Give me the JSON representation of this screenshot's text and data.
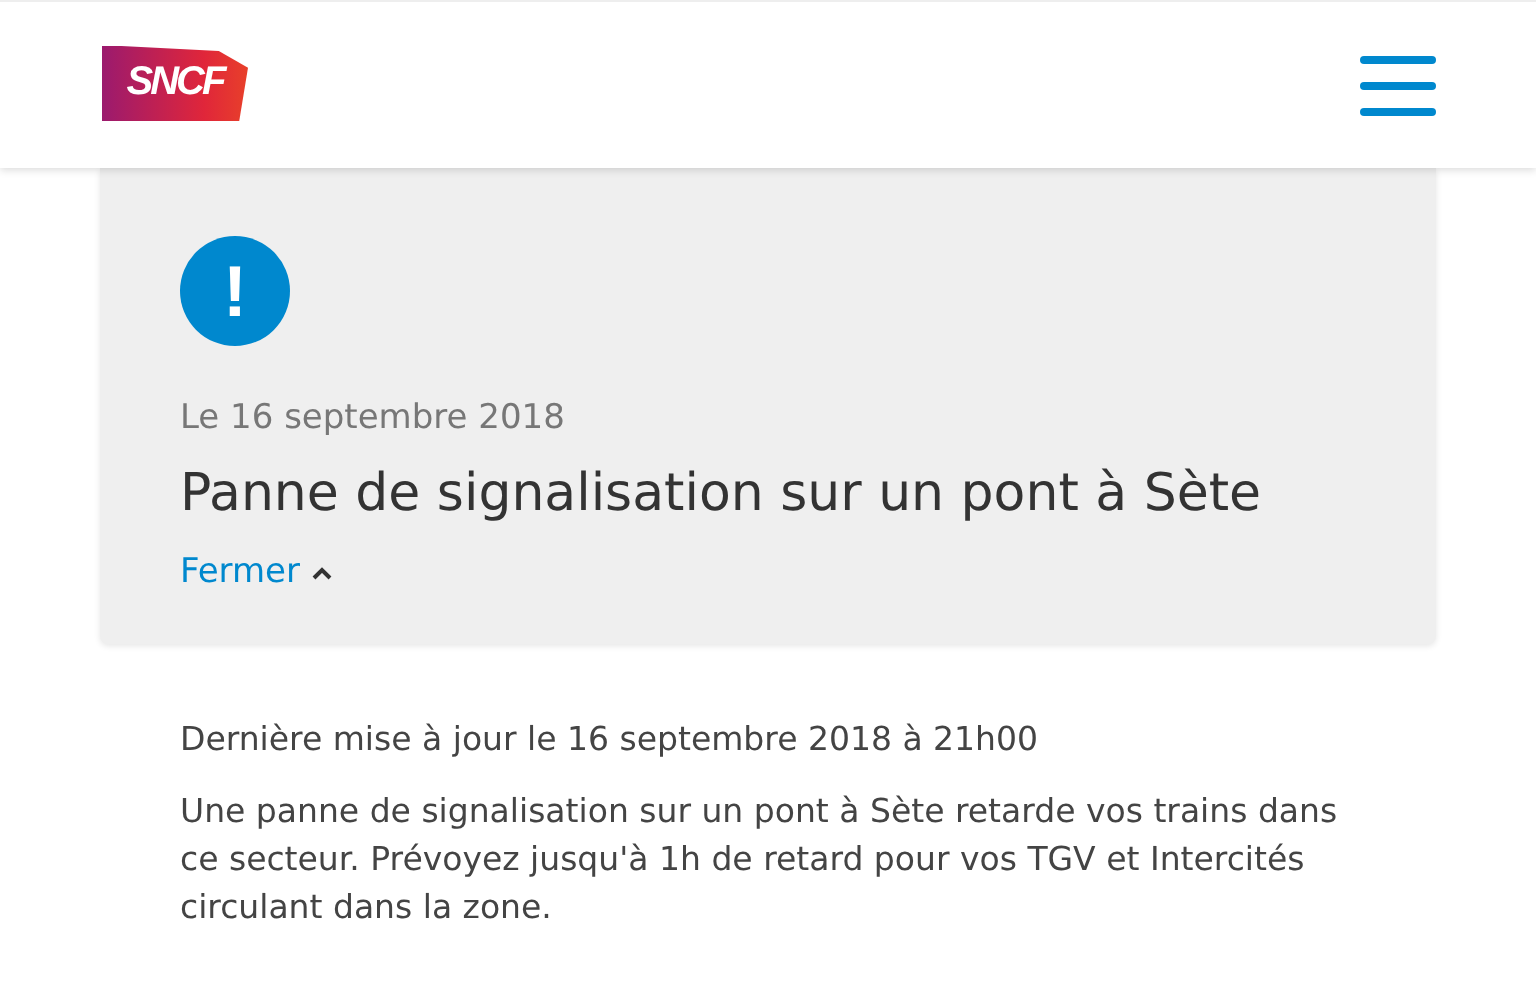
{
  "header": {
    "logo": "SNCF"
  },
  "alert": {
    "icon": "!",
    "date": "Le 16 septembre 2018",
    "title": "Panne de signalisation sur un pont à Sète",
    "toggle": {
      "label": "Fermer",
      "expanded": true
    }
  },
  "details": {
    "updated": "Dernière mise à jour le 16 septembre 2018 à 21h00",
    "body": "Une panne de signalisation sur un pont à Sète retarde vos trains dans ce secteur. Prévoyez jusqu'à 1h de retard pour vos TGV et Intercités circulant dans la zone."
  }
}
